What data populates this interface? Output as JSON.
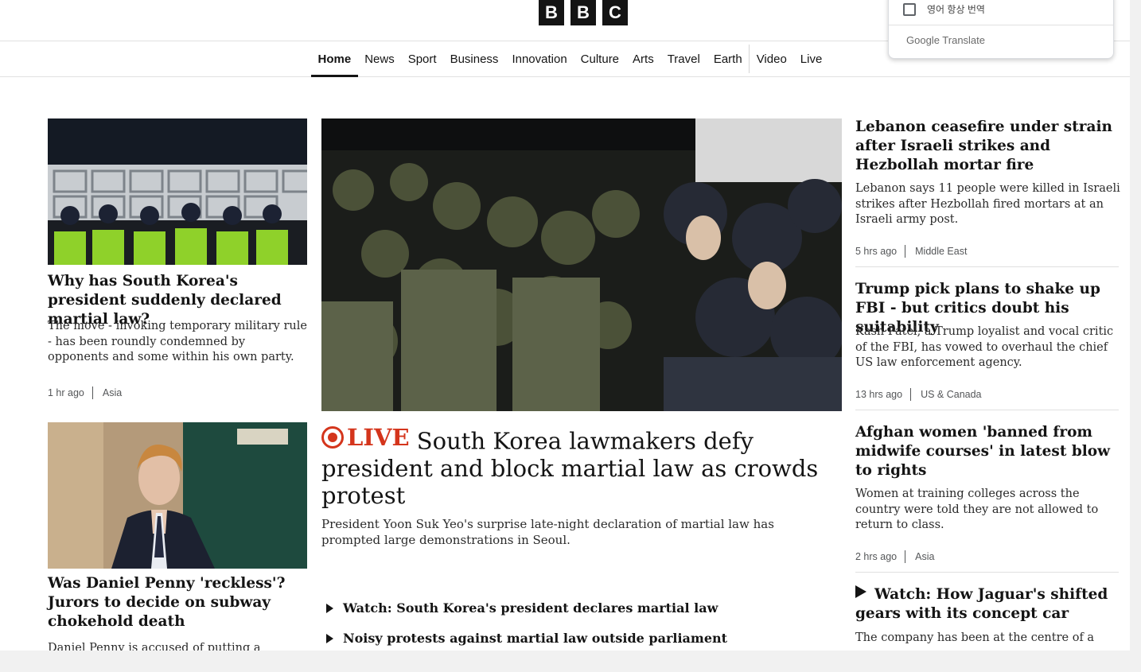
{
  "logo": [
    "B",
    "B",
    "C"
  ],
  "nav": {
    "items": [
      "Home",
      "News",
      "Sport",
      "Business",
      "Innovation",
      "Culture",
      "Arts",
      "Travel",
      "Earth"
    ],
    "items_after_sep": [
      "Video",
      "Live"
    ],
    "active": "Home"
  },
  "translate": {
    "checkbox_label": "영어 항상 번역",
    "brand": "Google Translate"
  },
  "left": {
    "story1": {
      "title": "Why has South Korea's president suddenly declared martial law?",
      "summary": "The move - invoking temporary military rule - has been roundly condemned by opponents and some within his own party.",
      "time": "1 hr ago",
      "section": "Asia"
    },
    "story2": {
      "title": "Was Daniel Penny 'reckless'? Jurors to decide on subway chokehold death",
      "summary": "Daniel Penny is accused of putting a"
    }
  },
  "center": {
    "live_label": "LIVE",
    "title": "South Korea lawmakers defy president and block martial law as crowds protest",
    "summary": "President Yoon Suk Yeo's surprise late-night declaration of martial law has prompted large demonstrations in Seoul.",
    "related": [
      "Watch: South Korea's president declares martial law",
      "Noisy protests against martial law outside parliament"
    ]
  },
  "right": {
    "stories": [
      {
        "title": "Lebanon ceasefire under strain after Israeli strikes and Hezbollah mortar fire",
        "summary": "Lebanon says 11 people were killed in Israeli strikes after Hezbollah fired mortars at an Israeli army post.",
        "time": "5 hrs ago",
        "section": "Middle East"
      },
      {
        "title": "Trump pick plans to shake up FBI - but critics doubt his suitability",
        "summary": "Kash Patel, a Trump loyalist and vocal critic of the FBI, has vowed to overhaul the chief US law enforcement agency.",
        "time": "13 hrs ago",
        "section": "US & Canada"
      },
      {
        "title": "Afghan women 'banned from midwife courses' in latest blow to rights",
        "summary": "Women at training colleges across the country were told they are not allowed to return to class.",
        "time": "2 hrs ago",
        "section": "Asia"
      },
      {
        "title": "Watch: How Jaguar's shifted gears with its concept car",
        "summary": "The company has been at the centre of a"
      }
    ]
  },
  "colors": {
    "live_red": "#d4351c",
    "text": "#141414",
    "meta": "#545658"
  }
}
